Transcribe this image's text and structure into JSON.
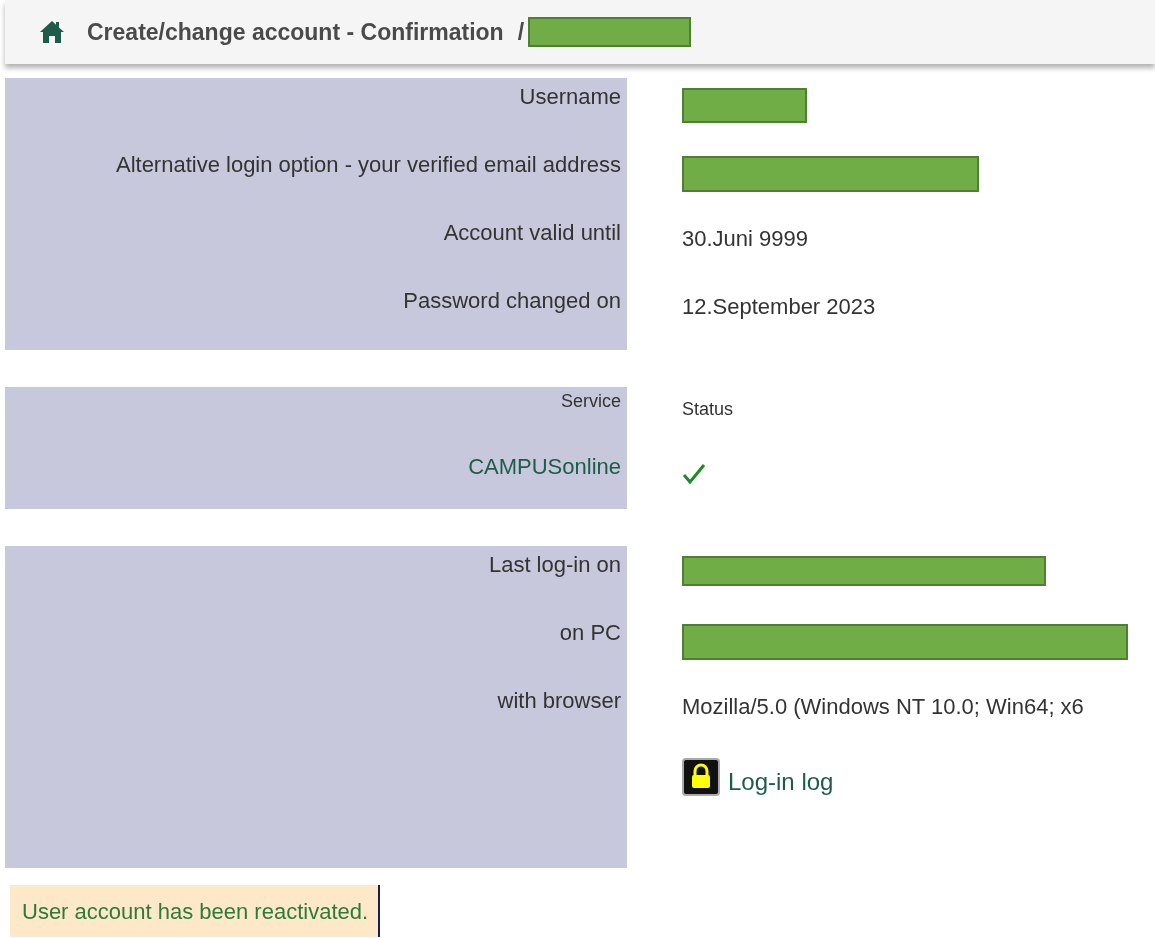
{
  "header": {
    "title": "Create/change account - Confirmation",
    "separator": "/",
    "trail": {
      "kind": "redacted"
    }
  },
  "sections": [
    {
      "rows": [
        {
          "kind": "field",
          "label": "Username",
          "value": {
            "kind": "redacted"
          }
        },
        {
          "kind": "field",
          "label": "Alternative login option - your verified email address",
          "value": {
            "kind": "redacted"
          }
        },
        {
          "kind": "field",
          "label": "Account valid until",
          "value": {
            "kind": "text",
            "text": "30.Juni 9999"
          }
        },
        {
          "kind": "field",
          "label": "Password changed on",
          "value": {
            "kind": "text",
            "text": "12.September 2023"
          }
        }
      ]
    },
    {
      "rows": [
        {
          "kind": "heading",
          "label": "Service",
          "value": {
            "kind": "text",
            "text": "Status"
          }
        },
        {
          "kind": "link",
          "label": "CAMPUSonline",
          "value": {
            "kind": "check"
          }
        }
      ]
    },
    {
      "rows": [
        {
          "kind": "field",
          "label": "Last log-in on",
          "value": {
            "kind": "redacted"
          }
        },
        {
          "kind": "field",
          "label": "on PC",
          "value": {
            "kind": "redacted"
          }
        },
        {
          "kind": "field",
          "label": "with browser",
          "value": {
            "kind": "text",
            "text": "Mozilla/5.0 (Windows NT 10.0; Win64; x6"
          }
        },
        {
          "kind": "tall",
          "value": {
            "kind": "lock-link",
            "text": "Log-in log"
          }
        }
      ]
    }
  ],
  "notice": {
    "text": "User account has been reactivated."
  }
}
